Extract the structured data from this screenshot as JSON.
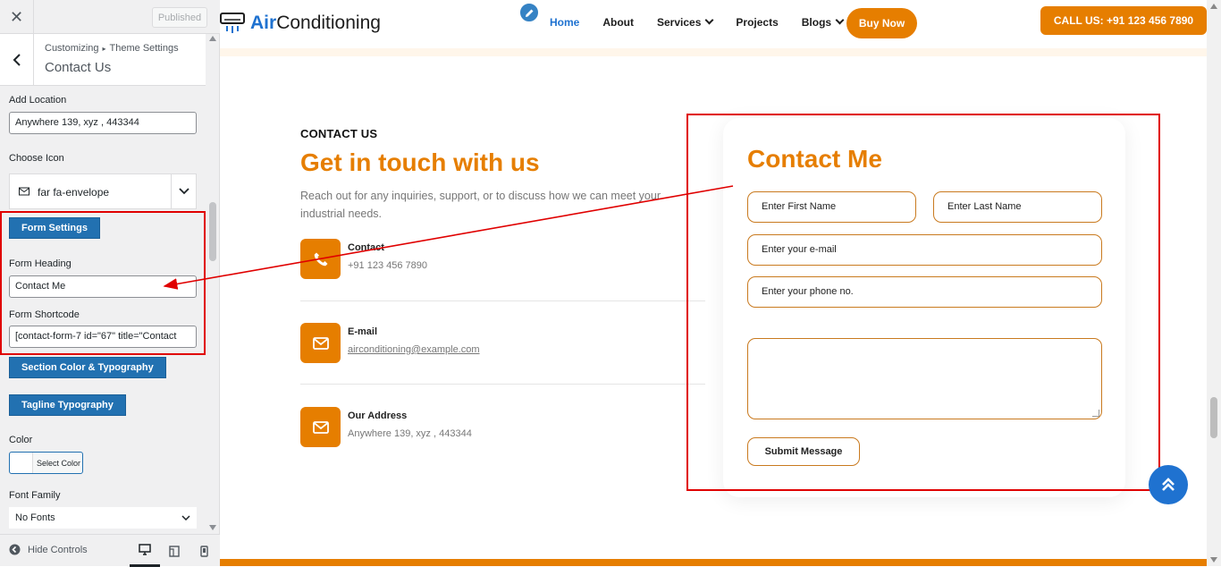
{
  "customizer": {
    "close_icon": "close-icon",
    "publish_label": "Published",
    "breadcrumb_root": "Customizing",
    "breadcrumb_parent": "Theme Settings",
    "section_title": "Contact Us",
    "fields": {
      "add_location_label": "Add Location",
      "add_location_value": "Anywhere 139, xyz , 443344",
      "choose_icon_label": "Choose Icon",
      "choose_icon_value": "far fa-envelope",
      "form_settings_button": "Form Settings",
      "form_heading_label": "Form Heading",
      "form_heading_value": "Contact Me",
      "form_shortcode_label": "Form Shortcode",
      "form_shortcode_value": "[contact-form-7 id=\"67\" title=\"Contact",
      "section_color_button": "Section Color & Typography",
      "tagline_typography_button": "Tagline Typography",
      "color_label": "Color",
      "select_color_label": "Select Color",
      "font_family_label": "Font Family",
      "font_family_value": "No Fonts"
    },
    "footer": {
      "hide_controls_label": "Hide Controls"
    }
  },
  "site": {
    "logo_accent": "Air",
    "logo_rest": "Conditioning",
    "nav": [
      {
        "label": "Home"
      },
      {
        "label": "About"
      },
      {
        "label": "Services"
      },
      {
        "label": "Projects"
      },
      {
        "label": "Blogs"
      }
    ],
    "buy_now_label": "Buy Now",
    "call_us_label": "CALL US: +91 123 456 7890",
    "colors": {
      "accent": "#e67e00",
      "brand_blue": "#1f72d0",
      "annotation_red": "#e00000"
    }
  },
  "contact": {
    "tagline": "CONTACT US",
    "heading": "Get in touch with us",
    "intro": "Reach out for any inquiries, support, or to discuss how we can meet your industrial needs.",
    "items": [
      {
        "title": "Contact",
        "value": "+91 123 456 7890",
        "icon": "phone-icon"
      },
      {
        "title": "E-mail",
        "value": "airconditioning@example.com",
        "icon": "envelope-icon"
      },
      {
        "title": "Our Address",
        "value": "Anywhere 139, xyz , 443344",
        "icon": "envelope-icon"
      }
    ]
  },
  "form": {
    "heading": "Contact Me",
    "first_name_placeholder": "Enter First Name",
    "last_name_placeholder": "Enter Last Name",
    "email_placeholder": "Enter your e-mail",
    "phone_placeholder": "Enter your phone no.",
    "submit_label": "Submit Message"
  }
}
